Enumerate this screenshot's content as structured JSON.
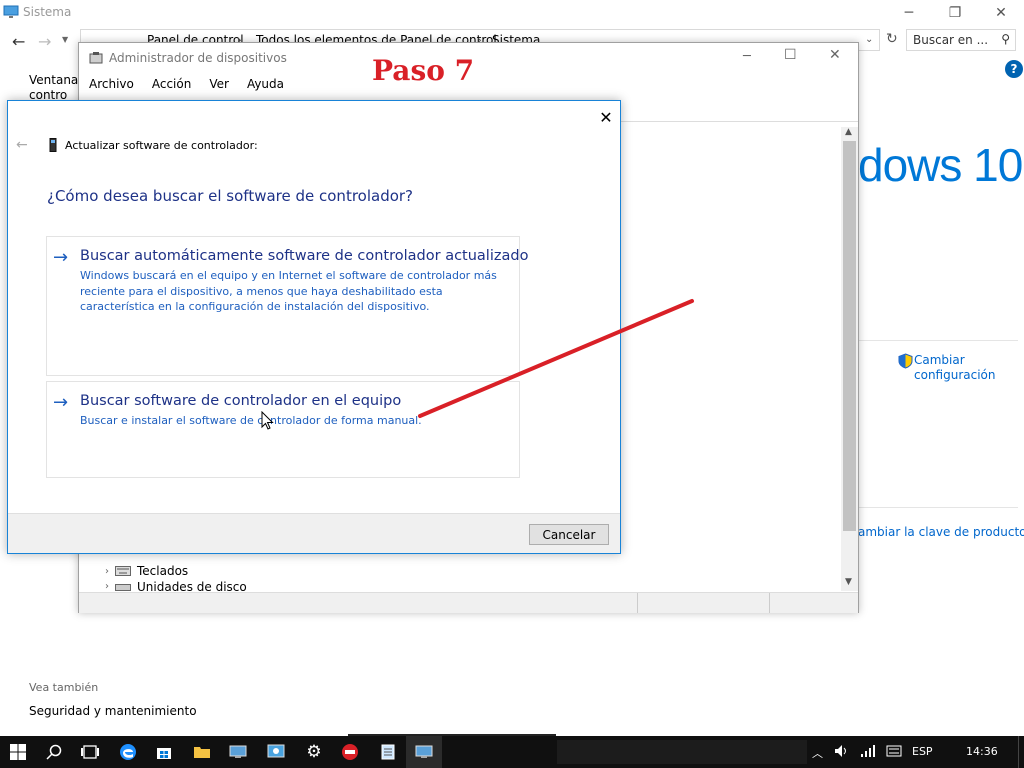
{
  "annotation": {
    "text": "Paso 7"
  },
  "system_window": {
    "title": "Sistema",
    "breadcrumbs": [
      "Panel de control",
      "Todos los elementos de Panel de control",
      "Sistema"
    ],
    "search_placeholder": "Buscar en ...",
    "left_link": [
      "Ventana p",
      "contro"
    ],
    "logo_text": "dows 10",
    "change_settings": [
      "Cambiar",
      "configuración"
    ],
    "change_product_key": "ambiar la clave de producto",
    "see_also": "Vea también",
    "security_link": "Seguridad y mantenimiento"
  },
  "device_manager": {
    "title": "Administrador de dispositivos",
    "menu": [
      "Archivo",
      "Acción",
      "Ver",
      "Ayuda"
    ],
    "tree_items": [
      "Teclados",
      "Unidades de disco"
    ]
  },
  "dialog": {
    "header": "Actualizar software de controlador:",
    "question": "¿Cómo desea buscar el software de controlador?",
    "options": [
      {
        "title": "Buscar automáticamente software de controlador actualizado",
        "description": "Windows buscará en el equipo y en Internet el software de controlador más reciente para el dispositivo, a menos que haya deshabilitado esta característica en la configuración de instalación del dispositivo."
      },
      {
        "title": "Buscar software de controlador en el equipo",
        "description": "Buscar e instalar el software de controlador de forma manual."
      }
    ],
    "cancel_label": "Cancelar"
  },
  "taskbar": {
    "language": "ESP",
    "time": "14:36"
  },
  "colors": {
    "annotation_red": "#d92027",
    "link_blue": "#0066cc",
    "dialog_title_blue": "#1e3287",
    "accent": "#0078d7"
  }
}
